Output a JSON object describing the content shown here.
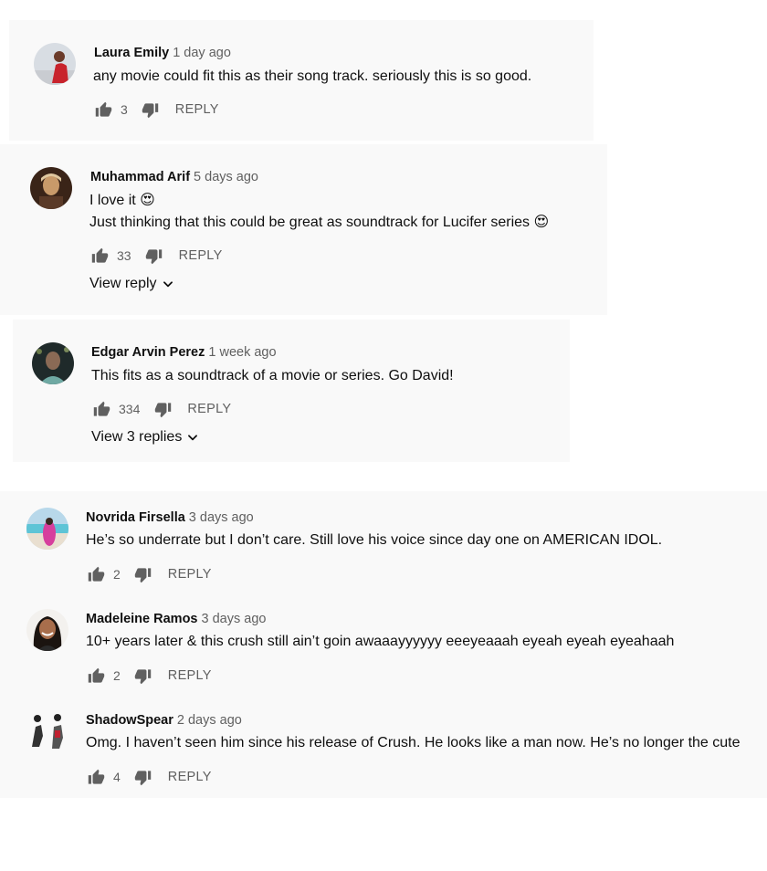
{
  "comments": [
    {
      "author": "Laura Emily",
      "time": "1 day ago",
      "text": "any movie could fit this as their song track. seriously this is so good.",
      "likes": "3",
      "reply_label": "REPLY",
      "avatar_icon": "avatar-laura-emily"
    },
    {
      "author": "Muhammad Arif",
      "time": "5 days ago",
      "text": "I love it 😍\nJust thinking that this could be great as soundtrack for Lucifer series 😍",
      "likes": "33",
      "reply_label": "REPLY",
      "view_replies": "View reply",
      "avatar_icon": "avatar-muhammad-arif"
    },
    {
      "author": "Edgar Arvin Perez",
      "time": "1 week ago",
      "text": "This fits as a soundtrack of a movie or series. Go David!",
      "likes": "334",
      "reply_label": "REPLY",
      "view_replies": "View 3 replies",
      "avatar_icon": "avatar-edgar-arvin-perez"
    },
    {
      "author": "Novrida Firsella",
      "time": "3 days ago",
      "text": "He’s so underrate but I don’t care. Still love his voice since day one on AMERICAN IDOL.",
      "likes": "2",
      "reply_label": "REPLY",
      "avatar_icon": "avatar-novrida-firsella"
    },
    {
      "author": "Madeleine Ramos",
      "time": "3 days ago",
      "text": "10+ years later & this crush still ain’t goin awaaayyyyyy eeeyeaaah eyeah eyeah eyeahaah",
      "likes": "2",
      "reply_label": "REPLY",
      "avatar_icon": "avatar-madeleine-ramos"
    },
    {
      "author": "ShadowSpear",
      "time": "2 days ago",
      "text": "Omg. I haven’t seen him since his release of Crush. He looks like a man now. He’s no longer the cute",
      "likes": "4",
      "reply_label": "REPLY",
      "avatar_icon": "avatar-shadowspear"
    }
  ],
  "icons": {
    "like": "thumbs-up-icon",
    "dislike": "thumbs-down-icon",
    "expand": "chevron-down-icon"
  },
  "colors": {
    "panel": "#f9f9f9",
    "secondary_text": "#606060",
    "primary_text": "#0f0f0f"
  }
}
